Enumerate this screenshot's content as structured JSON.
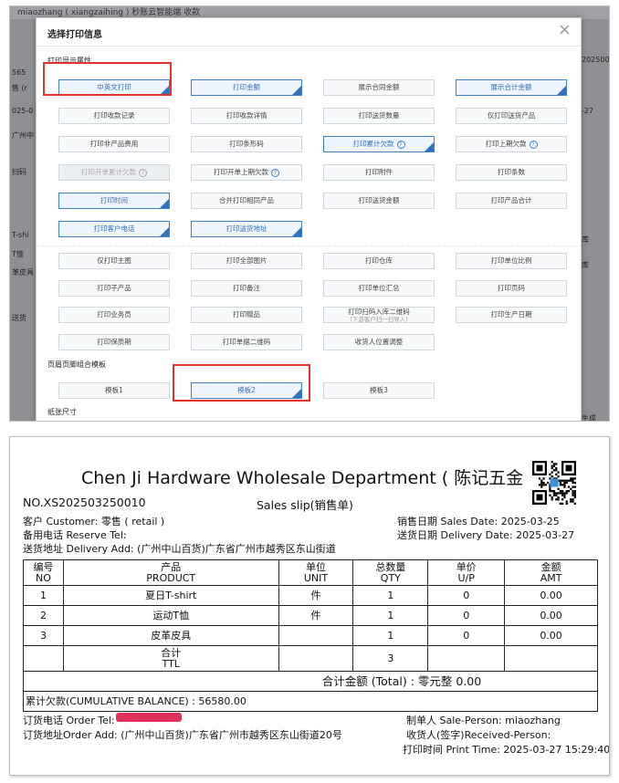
{
  "dialog": {
    "title": "选择打印信息",
    "section_display": "打印显示属性",
    "section_template": "页眉页脚组合模板",
    "section_paper": "纸张尺寸",
    "options_group1": [
      {
        "label": "中英文打印",
        "selected": true
      },
      {
        "label": "打印金额",
        "selected": true
      },
      {
        "label": "展示合同金额",
        "selected": false
      },
      {
        "label": "展示合计金额",
        "selected": true
      },
      {
        "label": "打印收款记录",
        "selected": false
      },
      {
        "label": "打印收款详情",
        "selected": false
      },
      {
        "label": "打印送货数量",
        "selected": false
      },
      {
        "label": "仅打印送货产品",
        "selected": false
      },
      {
        "label": "打印非产品费用",
        "selected": false
      },
      {
        "label": "打印条形码",
        "selected": false
      },
      {
        "label": "打印累计欠款",
        "selected": true,
        "help": true
      },
      {
        "label": "打印上期欠款",
        "selected": false,
        "help": true
      },
      {
        "label": "打印开单累计欠款",
        "selected": false,
        "help": true,
        "disabled": true
      },
      {
        "label": "打印开单上期欠款",
        "selected": false,
        "help": true
      },
      {
        "label": "打印附件",
        "selected": false
      },
      {
        "label": "打印条数",
        "selected": false
      },
      {
        "label": "打印时间",
        "selected": true
      },
      {
        "label": "合并打印相同产品",
        "selected": false
      },
      {
        "label": "打印送货金额",
        "selected": false
      },
      {
        "label": "打印产品合计",
        "selected": false
      },
      {
        "label": "打印客户电话",
        "selected": true
      },
      {
        "label": "打印送货地址",
        "selected": true
      }
    ],
    "options_group2": [
      {
        "label": "仅打印主图"
      },
      {
        "label": "打印全部图片"
      },
      {
        "label": "打印仓库"
      },
      {
        "label": "打印单位比例"
      },
      {
        "label": "打印子产品"
      },
      {
        "label": "打印备注"
      },
      {
        "label": "打印单位汇总"
      },
      {
        "label": "打印页码"
      },
      {
        "label": "打印业务员"
      },
      {
        "label": "打印赠品"
      },
      {
        "label": "打印扫码入库二维码",
        "sub": "(下游客户扫一扫导入)"
      },
      {
        "label": "打印生产日期"
      },
      {
        "label": "打印保质期"
      },
      {
        "label": "打印单据二维码"
      },
      {
        "label": "收货人位置调整"
      }
    ],
    "templates": [
      {
        "label": "模板1",
        "selected": false
      },
      {
        "label": "模板2",
        "selected": true
      },
      {
        "label": "模板3",
        "selected": false
      }
    ],
    "close_icon": "×"
  },
  "background": {
    "top_strip": "miaozhang ( xiangzaihing ) 秒账云智能端  收款  ",
    "left_fragments": [
      "565",
      "售 (r",
      "025-0",
      "广州中",
      "扫码",
      "T-shi",
      "T恤",
      "革皮具",
      "送货"
    ],
    "right_fragments": [
      "2025001",
      "-27",
      "库",
      "库",
      "生成"
    ]
  },
  "receipt": {
    "title": "Chen Ji Hardware Wholesale Department ( 陈记五金",
    "order_no": "NO.XS202503250010",
    "slip_label": "Sales slip(销售单)",
    "customer": "客户 Customer: 零售 ( retail )",
    "sales_date": "销售日期 Sales Date: 2025-03-25",
    "reserve_tel": "备用电话 Reserve Tel:",
    "delivery_date": "送货日期 Delivery Date: 2025-03-27",
    "delivery_add": "送货地址 Delivery Add: (广州中山百货)广东省广州市越秀区东山街道",
    "headers": [
      {
        "cn": "编号",
        "en": "NO"
      },
      {
        "cn": "产品",
        "en": "PRODUCT"
      },
      {
        "cn": "单位",
        "en": "UNIT"
      },
      {
        "cn": "总数量",
        "en": "QTY"
      },
      {
        "cn": "单价",
        "en": "U/P"
      },
      {
        "cn": "金额",
        "en": "AMT"
      }
    ],
    "rows": [
      {
        "no": "1",
        "product": "夏日T-shirt",
        "unit": "件",
        "qty": "1",
        "up": "0",
        "amt": "0.00"
      },
      {
        "no": "2",
        "product": "运动T恤",
        "unit": "件",
        "qty": "1",
        "up": "0",
        "amt": "0.00"
      },
      {
        "no": "3",
        "product": "皮革皮具",
        "unit": "",
        "qty": "1",
        "up": "0",
        "amt": "0.00"
      }
    ],
    "total_cn": "合计",
    "total_en": "TTL",
    "total_qty": "3",
    "grand_total": "合计金额 (Total) : 零元整 0.00",
    "cumulative": "累计欠款(CUMULATIVE BALANCE) : 56580.00",
    "order_tel": "订货电话 Order Tel:",
    "order_add": "订货地址Order Add: (广州中山百货)广东省广州市越秀区东山街道20号",
    "sales_person": "制单人 Sale-Person: miaozhang",
    "received_person": "收货人(签字)Received-Person:",
    "print_time": "打印时间 Print Time: 2025-03-27 15:29:40"
  },
  "colors": {
    "accent": "#2f73c0",
    "highlight_box": "#e0312b",
    "redaction": "#e0315a"
  }
}
